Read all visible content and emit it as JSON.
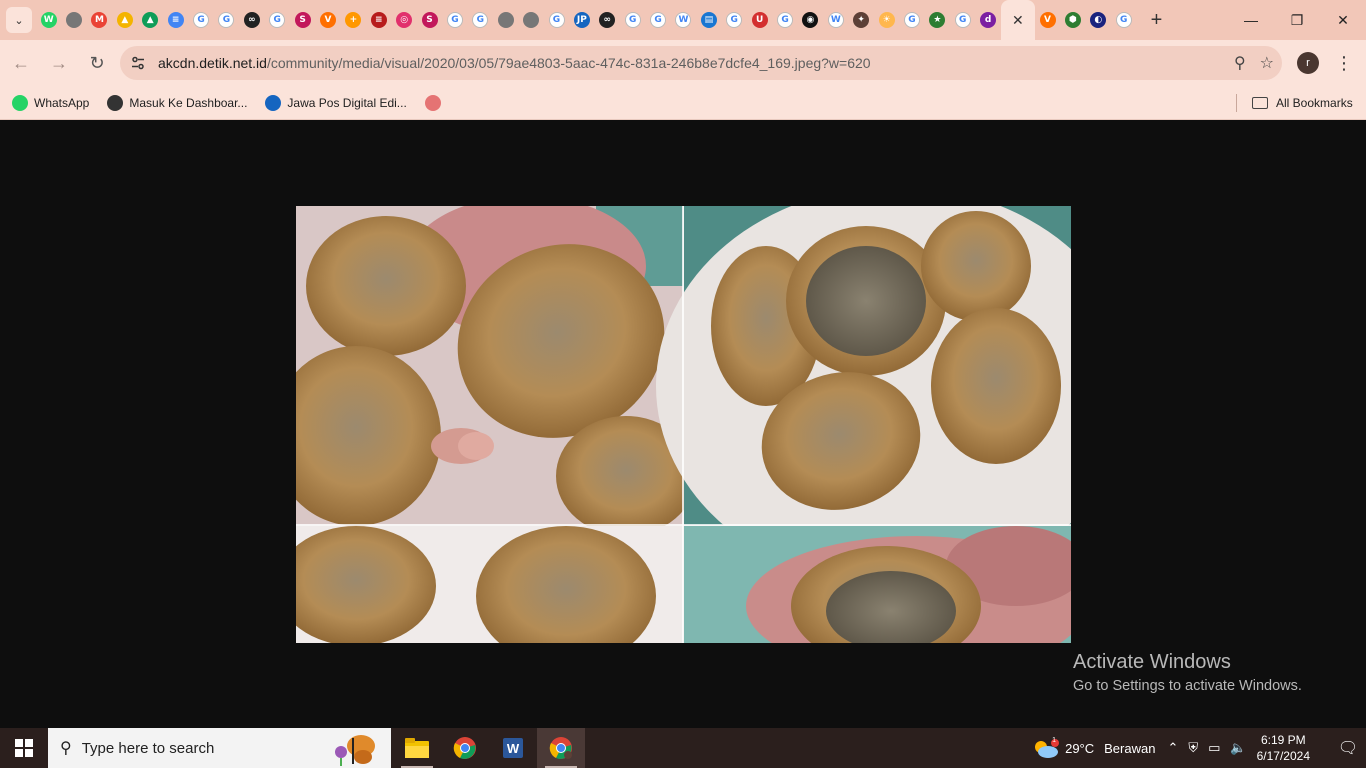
{
  "browser": {
    "tabs": [
      {
        "icon": "whatsapp-icon",
        "color": "#25d366",
        "glyph": "W"
      },
      {
        "icon": "globe-icon",
        "color": "#777777",
        "glyph": ""
      },
      {
        "icon": "gmail-icon",
        "color": "#ea4335",
        "glyph": "M"
      },
      {
        "icon": "drive-icon",
        "color": "#f4b400",
        "glyph": "▲"
      },
      {
        "icon": "drive-icon",
        "color": "#0f9d58",
        "glyph": "▲"
      },
      {
        "icon": "docs-icon",
        "color": "#4285f4",
        "glyph": "≡"
      },
      {
        "icon": "google-icon",
        "color": "#ffffff",
        "glyph": "G"
      },
      {
        "icon": "google-icon",
        "color": "#ffffff",
        "glyph": "G"
      },
      {
        "icon": "media-icon",
        "color": "#222222",
        "glyph": "∞"
      },
      {
        "icon": "google-icon",
        "color": "#ffffff",
        "glyph": "G"
      },
      {
        "icon": "s-icon",
        "color": "#c2185b",
        "glyph": "S"
      },
      {
        "icon": "v-icon",
        "color": "#ff6f00",
        "glyph": "V"
      },
      {
        "icon": "plus-icon",
        "color": "#ff9800",
        "glyph": "+"
      },
      {
        "icon": "news-icon",
        "color": "#b71c1c",
        "glyph": "≡"
      },
      {
        "icon": "instagram-icon",
        "color": "#e1306c",
        "glyph": "◎"
      },
      {
        "icon": "s-icon",
        "color": "#c2185b",
        "glyph": "S"
      },
      {
        "icon": "google-icon",
        "color": "#ffffff",
        "glyph": "G"
      },
      {
        "icon": "google-icon",
        "color": "#ffffff",
        "glyph": "G"
      },
      {
        "icon": "globe-icon",
        "color": "#777777",
        "glyph": ""
      },
      {
        "icon": "globe-icon",
        "color": "#777777",
        "glyph": ""
      },
      {
        "icon": "google-icon",
        "color": "#ffffff",
        "glyph": "G"
      },
      {
        "icon": "jawapos-icon",
        "color": "#1565c0",
        "glyph": "JP"
      },
      {
        "icon": "media-icon",
        "color": "#222222",
        "glyph": "∞"
      },
      {
        "icon": "google-icon",
        "color": "#ffffff",
        "glyph": "G"
      },
      {
        "icon": "google-icon",
        "color": "#ffffff",
        "glyph": "G"
      },
      {
        "icon": "wikipedia-icon",
        "color": "#ffffff",
        "glyph": "W"
      },
      {
        "icon": "chart-icon",
        "color": "#1976d2",
        "glyph": "▤"
      },
      {
        "icon": "google-icon",
        "color": "#ffffff",
        "glyph": "G"
      },
      {
        "icon": "u-icon",
        "color": "#d32f2f",
        "glyph": "U"
      },
      {
        "icon": "google-icon",
        "color": "#ffffff",
        "glyph": "G"
      },
      {
        "icon": "app-icon",
        "color": "#111111",
        "glyph": "◉"
      },
      {
        "icon": "wikipedia-icon",
        "color": "#ffffff",
        "glyph": "W"
      },
      {
        "icon": "bird-icon",
        "color": "#5d4037",
        "glyph": "✦"
      },
      {
        "icon": "sun-icon",
        "color": "#ffb74d",
        "glyph": "☀"
      },
      {
        "icon": "google-icon",
        "color": "#ffffff",
        "glyph": "G"
      },
      {
        "icon": "runner-icon",
        "color": "#2e7d32",
        "glyph": "★"
      },
      {
        "icon": "google-icon",
        "color": "#ffffff",
        "glyph": "G"
      },
      {
        "icon": "detik-icon",
        "color": "#7b1fa2",
        "glyph": "d"
      }
    ],
    "tabs_after": [
      {
        "icon": "v-icon",
        "color": "#ff6f00",
        "glyph": "V"
      },
      {
        "icon": "gem-icon",
        "color": "#2e7d32",
        "glyph": "⬢"
      },
      {
        "icon": "moon-icon",
        "color": "#1a237e",
        "glyph": "◐"
      },
      {
        "icon": "google-icon",
        "color": "#ffffff",
        "glyph": "G"
      }
    ],
    "url_domain": "akcdn.detik.net.id",
    "url_path": "/community/media/visual/2020/03/05/79ae4803-5aac-474c-831a-246b8e7dcfe4_169.jpeg?w=620",
    "profile_letter": "r",
    "bookmarks": [
      {
        "label": "WhatsApp",
        "icon": "whatsapp-icon",
        "color": "#25d366"
      },
      {
        "label": "Masuk Ke Dashboar...",
        "icon": "dashboard-icon",
        "color": "#333333"
      },
      {
        "label": "Jawa Pos Digital Edi...",
        "icon": "jawapos-icon",
        "color": "#1565c0"
      },
      {
        "label": "",
        "icon": "jds-icon",
        "color": "#e57373"
      }
    ],
    "all_bookmarks": "All Bookmarks"
  },
  "watermark": {
    "line1": "Activate Windows",
    "line2": "Go to Settings to activate Windows."
  },
  "taskbar": {
    "search_placeholder": "Type here to search",
    "weather_temp": "29°C",
    "weather_text": "Berawan",
    "weather_badge": "1",
    "time": "6:19 PM",
    "date": "6/17/2024"
  }
}
